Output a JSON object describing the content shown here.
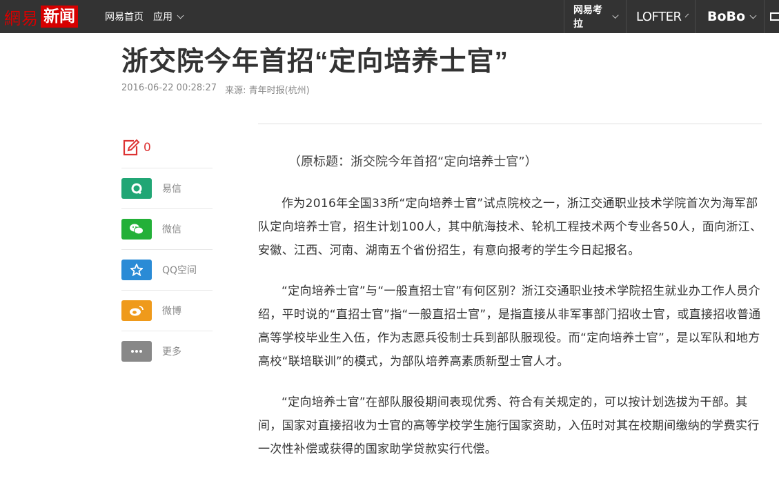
{
  "topbar": {
    "logo_part1": "網易",
    "logo_part2": "新闻",
    "nav": [
      "网易首页",
      "应用"
    ],
    "right_nav": [
      "网易考拉",
      "LOFTER",
      "BoBo"
    ]
  },
  "article": {
    "title": "浙交院今年首招“定向培养士官”",
    "time": "2016-06-22 00:28:27",
    "source": "来源: 青年时报(杭州)",
    "original_title": "（原标题：浙交院今年首招“定向培养士官”）",
    "paragraphs": [
      "作为2016年全国33所“定向培养士官”试点院校之一，浙江交通职业技术学院首次为海军部队定向培养士官，招生计划100人，其中航海技术、轮机工程技术两个专业各50人，面向浙江、安徽、江西、河南、湖南五个省份招生，有意向报考的学生今日起报名。",
      "“定向培养士官”与“一般直招士官”有何区别？浙江交通职业技术学院招生就业办工作人员介绍，平时说的“直招士官”指“一般直招士官”，是指直接从非军事部门招收士官，或直接招收普通高等学校毕业生入伍，作为志愿兵役制士兵到部队服现役。而“定向培养士官”，是以军队和地方高校“联培联训”的模式，为部队培养高素质新型士官人才。",
      "“定向培养士官”在部队服役期间表现优秀、符合有关规定的，可以按计划选拔为干部。其间，国家对直接招收为士官的高等学校学生施行国家资助，入伍时对其在校期间缴纳的学费实行一次性补偿或获得的国家助学贷款实行代偿。"
    ]
  },
  "share": {
    "comment_count": "0",
    "items": [
      {
        "label": "易信",
        "icon": "yixin-icon",
        "color": "#21a675"
      },
      {
        "label": "微信",
        "icon": "wechat-icon",
        "color": "#23b038"
      },
      {
        "label": "QQ空间",
        "icon": "qzone-icon",
        "color": "#2a8bd6"
      },
      {
        "label": "微博",
        "icon": "weibo-icon",
        "color": "#ef9a1b"
      },
      {
        "label": "更多",
        "icon": "more-icon",
        "color": "#888888"
      }
    ]
  }
}
